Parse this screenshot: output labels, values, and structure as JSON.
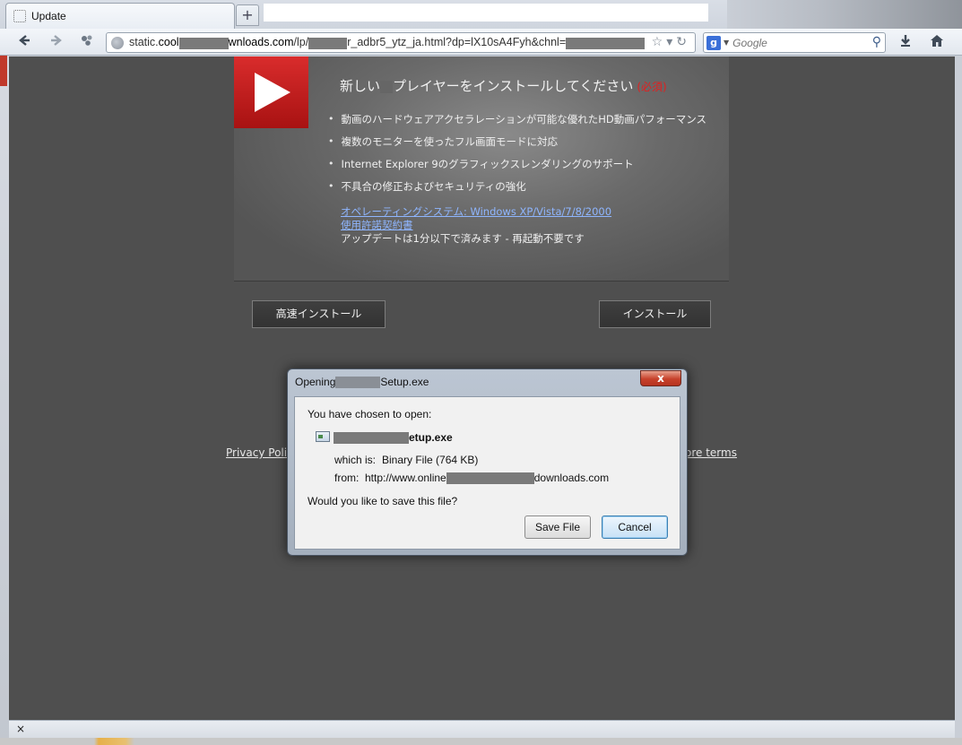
{
  "browser": {
    "tab_title": "Update",
    "new_tab_label": "+",
    "url_prefix": "static.",
    "url_host_start": "cool",
    "url_host_end": "wnloads.com",
    "url_path_start": "/lp/",
    "url_path_end": "r_adbr5_ytz_ja.html?dp=lX10sA4Fyh&chnl=",
    "search_placeholder": "Google",
    "search_engine_letter": "g"
  },
  "ad": {
    "title_start": "新しい",
    "title_end": "プレイヤーをインストールしてください",
    "title_required": "(必須)",
    "features": [
      "動画のハードウェアアクセラレーションが可能な優れたHD動画パフォーマンス",
      "複数のモニターを使ったフル画面モードに対応",
      "Internet Explorer 9のグラフィックスレンダリングのサポート",
      "不具合の修正およびセキュリティの強化"
    ],
    "os_link": "オペレーティングシステム: Windows XP/Vista/7/8/2000",
    "eula_link": "使用許諾契約書",
    "note": "アップデートは1分以下で済みます - 再起動不要です",
    "fast_install_label": "高速インストール",
    "install_label": "インストール"
  },
  "footer": {
    "privacy_label": "Privacy Polic",
    "terms_label": "ore terms"
  },
  "dialog": {
    "title_start": "Opening",
    "title_end": "Setup.exe",
    "close_label": "x",
    "chosen_label": "You have chosen to open:",
    "file_name_end": "etup.exe",
    "which_is_label": "which is:",
    "which_is_value": "Binary File (764 KB)",
    "from_label": "from:",
    "from_start": "http://www.online",
    "from_end": "downloads.com",
    "question": "Would you like to save this file?",
    "save_label": "Save File",
    "cancel_label": "Cancel"
  },
  "status": {
    "close_label": "×"
  },
  "icons": {
    "back": "back-arrow-icon",
    "forward": "forward-arrow-icon",
    "addon": "addon-icon",
    "site": "globe-icon",
    "bookmark": "star-icon",
    "reload": "reload-icon",
    "search": "magnifier-icon",
    "download": "download-icon",
    "home": "home-icon",
    "play": "play-icon",
    "file": "file-icon"
  },
  "colors": {
    "page_background": "#4f4f4f",
    "play_red": "#c81e1e",
    "required_red": "#e02020",
    "link_blue": "#8fb6ff"
  }
}
